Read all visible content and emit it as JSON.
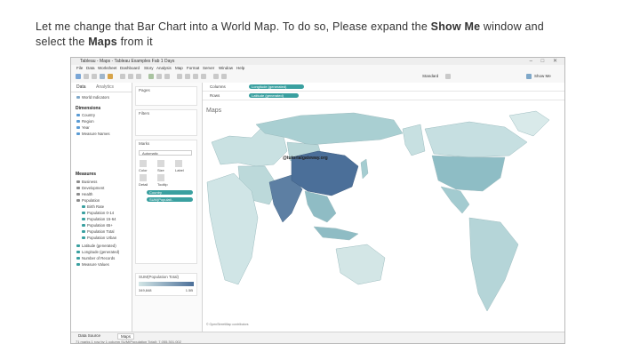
{
  "caption": {
    "line1_pre": "Let me change that Bar Chart into a World Map. To do so, Please expand the ",
    "line1_bold": "Show Me",
    "line1_post": " window and",
    "line2_pre": "select the ",
    "line2_bold": "Maps",
    "line2_post": " from it"
  },
  "window": {
    "title": "Tableau - Maps - Tableau Examples Fab 1 Days",
    "controls": "– □ ✕"
  },
  "menu": [
    "File",
    "Data",
    "Worksheet",
    "Dashboard",
    "Story",
    "Analysis",
    "Map",
    "Format",
    "Server",
    "Window",
    "Help"
  ],
  "toolbar": {
    "right_label": "Standard",
    "show_me": "Show Me"
  },
  "data_pane": {
    "tab_data": "Data",
    "tab_analytics": "Analytics",
    "datasource": "World Indicators",
    "dimensions_label": "Dimensions",
    "dimensions": [
      "Country",
      "Region",
      "Year",
      "Measure Names"
    ],
    "measures_label": "Measures",
    "measures": [
      "Business",
      "Development",
      "Health",
      "Population",
      "Birth Rate",
      "Population 0-14",
      "Population 15-64",
      "Population 65+",
      "Population Total",
      "Population Urban",
      "Latitude (generated)",
      "Longitude (generated)",
      "Number of Records",
      "Measure Values"
    ]
  },
  "cards": {
    "pages": "Pages",
    "filters": "Filters",
    "marks": "Marks",
    "mark_type": "Automatic",
    "buttons": [
      "Color",
      "Size",
      "Label",
      "Detail",
      "Tooltip"
    ],
    "pill_country": "Country",
    "pill_sum": "SUM(Populati..",
    "legend_title": "SUM(Population Total)",
    "legend_min": "349,848",
    "legend_max": "1.5B"
  },
  "shelves": {
    "columns_label": "Columns",
    "columns_pill": "Longitude (generated)",
    "rows_label": "Rows",
    "rows_pill": "Latitude (generated)"
  },
  "viz": {
    "title": "Maps",
    "watermark": "@tutorialgateway.org",
    "map_credit": "© OpenStreetMap contributors"
  },
  "statusbar": {
    "datasource_tab": "Data Source",
    "sheet_tab": "Maps",
    "info": "71 marks  1 row by 1 column  SUM(Population Total): 7,055,301,002"
  },
  "colors": {
    "pill": "#3aa0a0",
    "map_low": "#d3e6e6",
    "map_high": "#4b6f99",
    "ocean": "#ffffff"
  }
}
